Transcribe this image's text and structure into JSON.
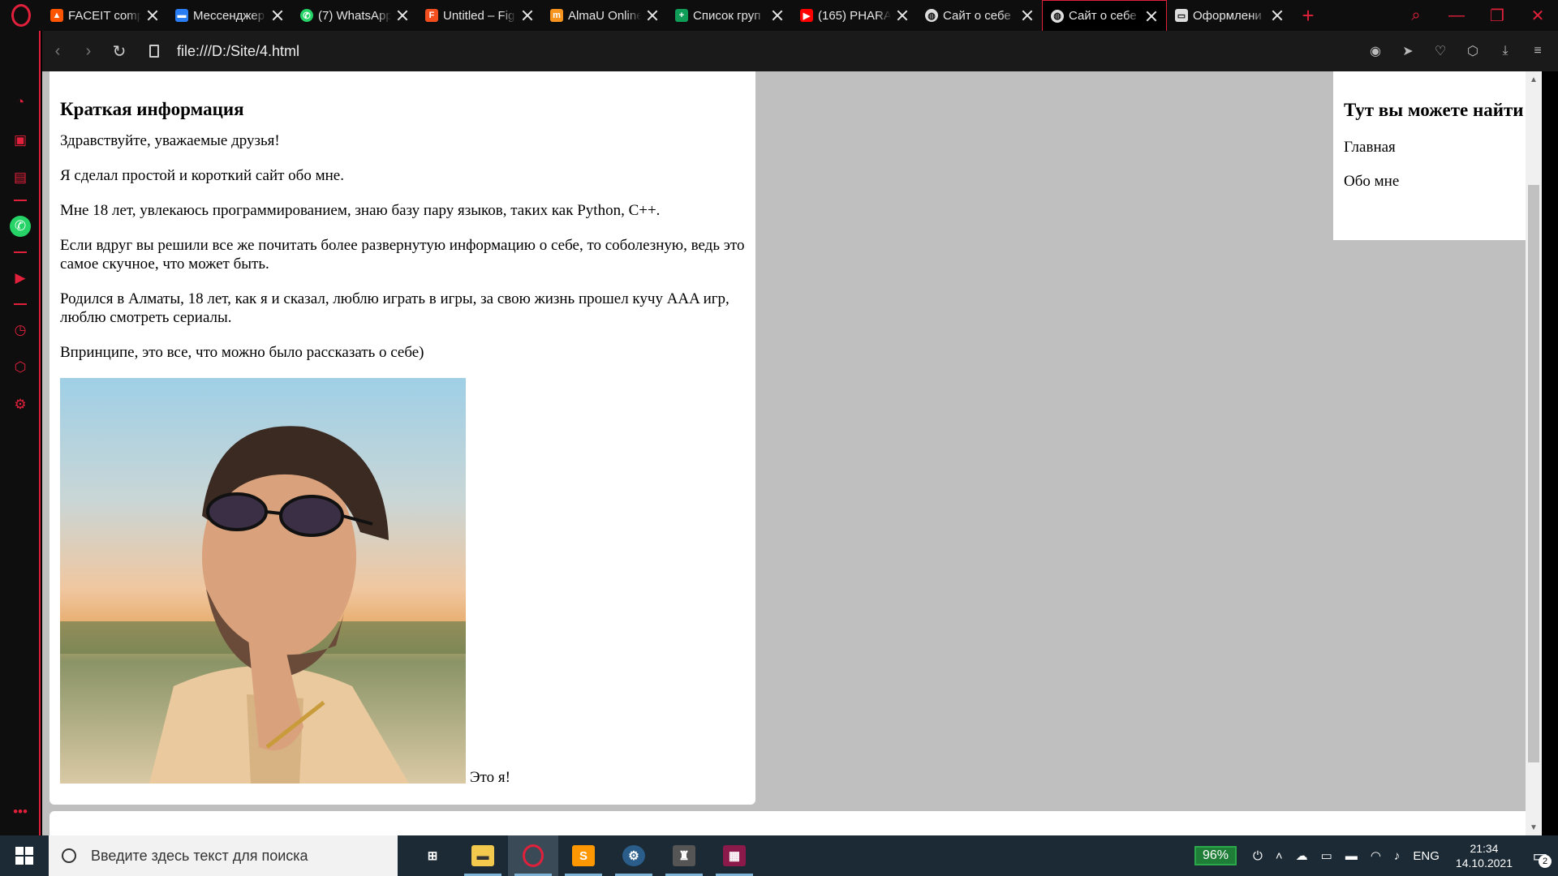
{
  "tabs": [
    {
      "label": "FACEIT comp",
      "icon": "faceit-icon",
      "color": "#ff5500"
    },
    {
      "label": "Мессенджер",
      "icon": "messenger-icon",
      "color": "#2a7ef5"
    },
    {
      "label": "(7) WhatsApp",
      "icon": "whatsapp-icon",
      "color": "#25d366"
    },
    {
      "label": "Untitled – Fig",
      "icon": "figma-icon",
      "color": "#f24e1e"
    },
    {
      "label": "AlmaU Online",
      "icon": "almau-icon",
      "color": "#f7941d"
    },
    {
      "label": "Список груп",
      "icon": "sheets-icon",
      "color": "#0f9d58"
    },
    {
      "label": "(165) PHARA",
      "icon": "youtube-icon",
      "color": "#ff0000"
    },
    {
      "label": "Сайт о себе",
      "icon": "globe-icon",
      "color": "#dddddd"
    },
    {
      "label": "Сайт о себе",
      "icon": "globe-icon",
      "color": "#dddddd",
      "active": true
    },
    {
      "label": "Оформлени",
      "icon": "chat-icon",
      "color": "#dddddd"
    }
  ],
  "address": {
    "url": "file:///D:/Site/4.html"
  },
  "page": {
    "main": {
      "heading": "Краткая информация",
      "paragraphs": [
        "Здравствуйте, уважаемые друзья!",
        "Я сделал простой и короткий сайт обо мне.",
        "Мне 18 лет, увлекаюсь программированием, знаю базу пару языков, таких как Python, C++.",
        "Если вдруг вы решили все же почитать более развернутую информацию о себе, то соболезную, ведь это самое скучное, что может быть.",
        "Родился в Алматы, 18 лет, как я и сказал, люблю играть в игры, за свою жизнь прошел кучу AAA игр, люблю смотреть сериалы.",
        "Впринципе, это все, что можно было рассказать о себе)"
      ],
      "photo_caption": "Это я!"
    },
    "side": {
      "heading": "Тут вы можете найти",
      "links": [
        "Главная",
        "Обо мне"
      ]
    }
  },
  "taskbar": {
    "search_placeholder": "Введите здесь текст для поиска",
    "battery": "96%",
    "lang": "ENG",
    "time": "21:34",
    "date": "14.10.2021",
    "notifications": "2"
  },
  "colors": {
    "accent": "#e1203b",
    "page_bg": "#bfbfbf",
    "card_bg": "#ffffff"
  }
}
